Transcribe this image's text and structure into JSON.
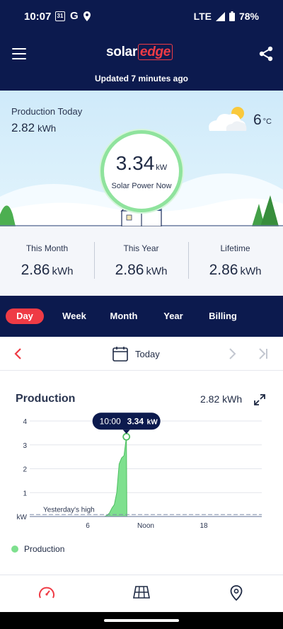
{
  "status_bar": {
    "time": "10:07",
    "calendar_day": "31",
    "g_label": "G",
    "network": "LTE",
    "battery": "78%"
  },
  "app_bar": {
    "logo_part1": "solar",
    "logo_part2": "edge",
    "updated_text": "Updated 7 minutes ago"
  },
  "hero": {
    "production_today_label": "Production Today",
    "production_today_value": "2.82",
    "production_today_unit": "kWh",
    "temperature_value": "6",
    "temperature_unit": "°C",
    "power_value": "3.34",
    "power_unit": "kW",
    "power_label": "Solar Power Now"
  },
  "stats": [
    {
      "label": "This Month",
      "value": "2.86",
      "unit": "kWh"
    },
    {
      "label": "This Year",
      "value": "2.86",
      "unit": "kWh"
    },
    {
      "label": "Lifetime",
      "value": "2.86",
      "unit": "kWh"
    }
  ],
  "tabs": [
    {
      "label": "Day",
      "active": true
    },
    {
      "label": "Week",
      "active": false
    },
    {
      "label": "Month",
      "active": false
    },
    {
      "label": "Year",
      "active": false
    },
    {
      "label": "Billing",
      "active": false
    }
  ],
  "date_nav": {
    "label": "Today"
  },
  "chart": {
    "title": "Production",
    "total": "2.82 kWh",
    "legend_label": "Production"
  },
  "chart_data": {
    "type": "area",
    "title": "Production",
    "xlabel": "",
    "ylabel": "kW",
    "x_ticks": [
      {
        "label": "6",
        "hour": 6
      },
      {
        "label": "Noon",
        "hour": 12
      },
      {
        "label": "18",
        "hour": 18
      }
    ],
    "y_ticks": [
      1,
      2,
      3,
      4
    ],
    "xlim": [
      0,
      24
    ],
    "ylim": [
      0,
      4
    ],
    "series": [
      {
        "name": "Production",
        "color": "#7ee08e",
        "x": [
          7.75,
          8.0,
          8.25,
          8.5,
          8.75,
          9.0,
          9.25,
          9.5,
          9.75,
          10.0,
          10.05
        ],
        "y": [
          0.0,
          0.05,
          0.15,
          0.35,
          0.5,
          1.0,
          2.2,
          2.45,
          2.55,
          3.34,
          0.0
        ]
      }
    ],
    "reference_line": {
      "label": "Yesterday's high",
      "y": 0.08
    },
    "tooltip": {
      "time": "10:00",
      "value": "3.34",
      "unit": "kW"
    }
  },
  "colors": {
    "navy": "#0c1a4e",
    "accent_red": "#ef3b45",
    "green": "#7ee08e"
  },
  "bottom_nav": [
    "dashboard-icon",
    "solar-panel-icon",
    "location-icon"
  ]
}
